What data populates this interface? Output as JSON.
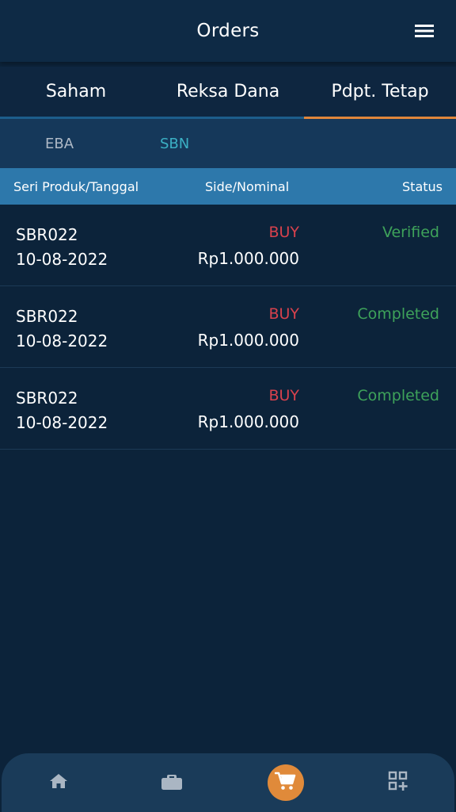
{
  "header": {
    "title": "Orders",
    "menu_icon": "hamburger-menu-icon"
  },
  "main_tabs": [
    {
      "label": "Saham",
      "active": false
    },
    {
      "label": "Reksa Dana",
      "active": false
    },
    {
      "label": "Pdpt. Tetap",
      "active": true
    }
  ],
  "sub_tabs": [
    {
      "label": "EBA",
      "active": false
    },
    {
      "label": "SBN",
      "active": true
    }
  ],
  "table": {
    "columns": [
      "Seri Produk/Tanggal",
      "Side/Nominal",
      "Status"
    ],
    "rows": [
      {
        "product": "SBR022",
        "date": "10-08-2022",
        "side": "BUY",
        "nominal": "Rp1.000.000",
        "status": "Verified"
      },
      {
        "product": "SBR022",
        "date": "10-08-2022",
        "side": "BUY",
        "nominal": "Rp1.000.000",
        "status": "Completed"
      },
      {
        "product": "SBR022",
        "date": "10-08-2022",
        "side": "BUY",
        "nominal": "Rp1.000.000",
        "status": "Completed"
      }
    ]
  },
  "bottom_nav": [
    {
      "icon": "home-icon",
      "active": false
    },
    {
      "icon": "briefcase-icon",
      "active": false
    },
    {
      "icon": "shopping-cart-icon",
      "active": true
    },
    {
      "icon": "apps-add-icon",
      "active": false
    }
  ],
  "colors": {
    "background": "#0c233a",
    "accent": "#e08a3a",
    "table_header": "#2d78ab",
    "buy": "#d8424d",
    "status_ok": "#3ea25a",
    "sbn_active": "#3bb0c4"
  }
}
